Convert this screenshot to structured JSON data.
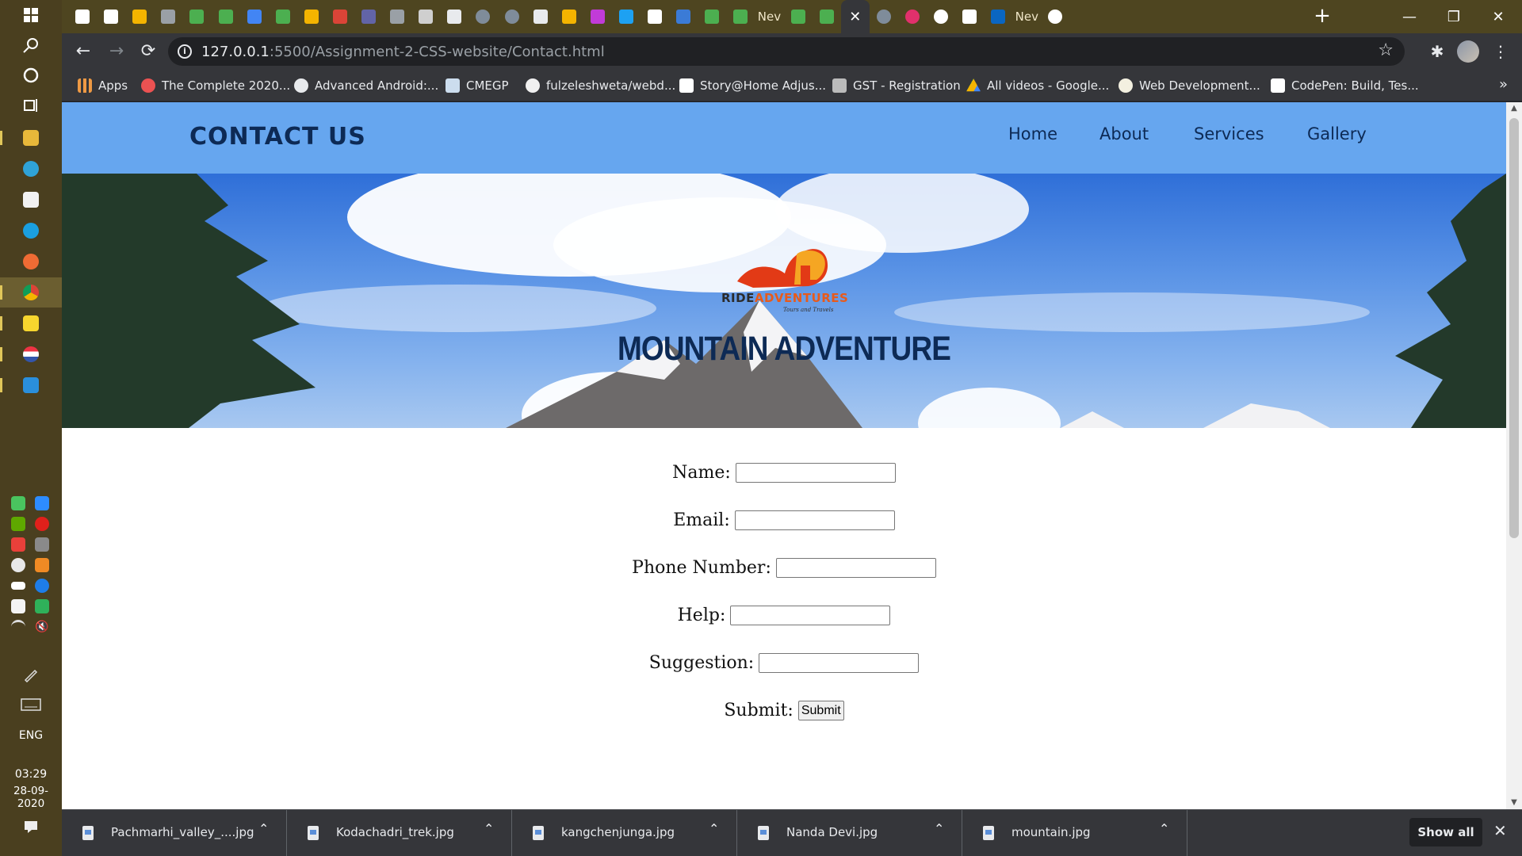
{
  "taskbar": {
    "language": "ENG",
    "time": "03:29",
    "date": "28-09-2020"
  },
  "browser": {
    "tabs": [
      {
        "icon": "codepen-icon"
      },
      {
        "icon": "codepen-icon"
      },
      {
        "icon": "drive-icon"
      },
      {
        "icon": "page-icon"
      },
      {
        "icon": "w3schools-icon"
      },
      {
        "icon": "w3schools-icon"
      },
      {
        "icon": "ads-icon"
      },
      {
        "icon": "w3schools-icon"
      },
      {
        "icon": "slides-icon"
      },
      {
        "icon": "gmail-icon"
      },
      {
        "icon": "teams-icon"
      },
      {
        "icon": "page-icon"
      },
      {
        "icon": "bookmark-icon"
      },
      {
        "icon": "wordpress-icon"
      },
      {
        "icon": "circle-icon"
      },
      {
        "icon": "circle-icon"
      },
      {
        "icon": "wordpress-icon"
      },
      {
        "icon": "drive-icon"
      },
      {
        "icon": "picsart-icon"
      },
      {
        "icon": "twitter-icon"
      },
      {
        "icon": "codepen-icon"
      },
      {
        "icon": "fx-icon"
      },
      {
        "icon": "w3schools-icon"
      },
      {
        "icon": "w3schools-icon"
      },
      {
        "label": "Nev"
      },
      {
        "icon": "w3schools-icon"
      },
      {
        "icon": "w3schools-icon"
      },
      {
        "icon": "close-icon"
      },
      {
        "icon": "circle-icon"
      },
      {
        "icon": "instagram-icon"
      },
      {
        "icon": "google-icon"
      },
      {
        "icon": "codepen-icon"
      },
      {
        "icon": "linkedin-icon"
      },
      {
        "label": "Nev"
      },
      {
        "icon": "google-icon"
      }
    ],
    "new_tab_label": "+",
    "window_controls": {
      "minimize": "—",
      "restore": "❐",
      "close": "✕"
    },
    "url": {
      "host": "127.0.0.1",
      "rest": ":5500/Assignment-2-CSS-website/Contact.html"
    },
    "bookmarks": [
      "Apps",
      "The Complete 2020...",
      "Advanced Android:...",
      "CMEGP",
      "fulzeleshweta/webd...",
      "Story@Home Adjus...",
      "GST - Registration",
      "All videos - Google...",
      "Web Development...",
      "CodePen: Build, Tes..."
    ],
    "bookmarks_more": "»"
  },
  "site": {
    "title": "CONTACT US",
    "nav": [
      "Home",
      "About",
      "Services",
      "Gallery"
    ],
    "logo": {
      "ride": "RIDE",
      "adventures": "ADVENTURES",
      "tagline": "Tours and Travels"
    },
    "hero_title": "MOUNTAIN ADVENTURE",
    "form": {
      "name_label": "Name:",
      "email_label": "Email:",
      "phone_label": "Phone Number:",
      "help_label": "Help:",
      "suggestion_label": "Suggestion:",
      "submit_label": "Submit:",
      "submit_button": "Submit"
    }
  },
  "downloads": {
    "files": [
      "Pachmarhi_valley_....jpg",
      "Kodachadri_trek.jpg",
      "kangchenjunga.jpg",
      "Nanda Devi.jpg",
      "mountain.jpg"
    ],
    "show_all": "Show all"
  },
  "colors": {
    "header_bg": "#66a6ef",
    "title_text": "#0d2a55",
    "tabstrip_bg": "#4e4520",
    "taskbar_bg": "#4a3f1f"
  }
}
